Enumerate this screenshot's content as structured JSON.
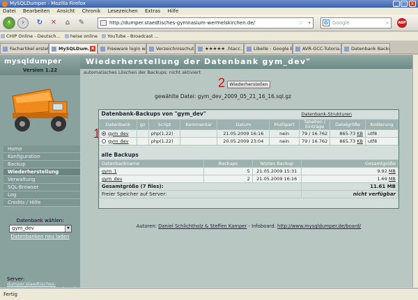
{
  "window": {
    "title": "MySQLDumper - Mozilla Firefox"
  },
  "menubar": {
    "items": [
      "Datei",
      "Bearbeiten",
      "Ansicht",
      "Chronik",
      "Lesezeichen",
      "Extras",
      "Hilfe"
    ]
  },
  "navbar": {
    "url": "http://dumper.staedtisches-gymnasium-wermelskirchen.de/",
    "search_placeholder": "Google"
  },
  "bookmarks": [
    "CHIP Online - Deutsch...",
    "heise online",
    "YouTube - Broadcast ..."
  ],
  "tabs": [
    {
      "label": "Fachartikel erstel...",
      "active": false
    },
    {
      "label": "MySQLDum...",
      "active": true
    },
    {
      "label": "Freeware login wi...",
      "active": false
    },
    {
      "label": "Verzeichnisschut...",
      "active": false
    },
    {
      "label": "★★★★★ .htacc...",
      "active": false
    },
    {
      "label": "Libelle - Google Bi...",
      "active": false
    },
    {
      "label": "AVR-GCC-Tutoria...",
      "active": false
    },
    {
      "label": "Datenbank Backu...",
      "active": false
    }
  ],
  "app": {
    "logo": "mysqldumper",
    "version": "Version 1.22",
    "page_title": "Wiederherstellung der Datenbank gym_dev\"",
    "subtitle": "automatisches Löschen der Backups: nicht aktiviert",
    "menu": [
      "Home",
      "Konfiguration",
      "Backup",
      "Wiederherstellung",
      "Verwaltung",
      "SQL-Browser",
      "Log",
      "Credits / Hilfe"
    ],
    "menu_active": "Wiederherstellung",
    "db_label": "Datenbank wählen:",
    "db_value": "gym_dev",
    "db_reload": "Datenbanken neu laden",
    "server_label": "Server:",
    "server_value": "dumper.staedtisches-gymnasium-wermelskirchen.de"
  },
  "markers": {
    "one": "1",
    "two": "2"
  },
  "restore": {
    "button": "Wiederherstellen",
    "selected_file": "gewählte Datei: gym_dev_2009_05_21_16_16.sql.gz"
  },
  "backups": {
    "title": "Datenbank-Backups von \"gym_dev\"",
    "structures_link": "Datenbank-Strukturen",
    "headers": [
      "Datenbank",
      "gz",
      "Script",
      "Kommentar",
      "Datum",
      "Multipart",
      "Tabellen / Einträge",
      "Dateigröße",
      "Kodierung"
    ],
    "rows": [
      {
        "db": "gym_dev",
        "gz": "",
        "script": "php(1.22)",
        "comment": "",
        "date": "21.05.2009 16:16",
        "multipart": "nein",
        "tables": "79 / 16.762",
        "size": "865.73",
        "unit": "KB",
        "enc": "utf8",
        "selected": true
      },
      {
        "db": "gym_dev",
        "gz": "",
        "script": "php(1.22)",
        "comment": "",
        "date": "20.05.2009 23:04",
        "multipart": "nein",
        "tables": "79 / 16.762",
        "size": "865.73",
        "unit": "KB",
        "enc": "utf8",
        "selected": false
      }
    ]
  },
  "all_backups": {
    "title": "alle Backups",
    "headers": [
      "Datenbankname",
      "Backups",
      "letztes Backup",
      "Gesamtgröße"
    ],
    "rows": [
      {
        "name": "gym_1",
        "count": "5",
        "last": "21.05.2009 15:31",
        "size": "9.92",
        "unit": "MB"
      },
      {
        "name": "gym_dev",
        "count": "2",
        "last": "21.05.2009 16:16",
        "size": "1.69",
        "unit": "MB"
      }
    ],
    "total_label": "Gesamtgröße (7 files):",
    "total_value": "11.61 MB",
    "free_label": "Freier Speicher auf Server:",
    "free_value": "nicht verfügbar"
  },
  "footer": {
    "authors_label": "Autoren:",
    "authors": "Daniel Schlichtholz & Steffen Kamper",
    "board_label": "- Infoboard:",
    "board_url": "http://www.mysqldumper.de/board/"
  },
  "status": {
    "text": "Fertig"
  }
}
